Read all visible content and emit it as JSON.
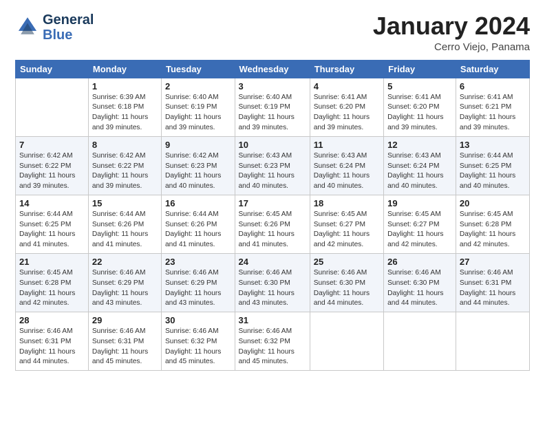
{
  "header": {
    "logo_line1": "General",
    "logo_line2": "Blue",
    "month_title": "January 2024",
    "subtitle": "Cerro Viejo, Panama"
  },
  "days_of_week": [
    "Sunday",
    "Monday",
    "Tuesday",
    "Wednesday",
    "Thursday",
    "Friday",
    "Saturday"
  ],
  "weeks": [
    [
      {
        "day": "",
        "info": ""
      },
      {
        "day": "1",
        "info": "Sunrise: 6:39 AM\nSunset: 6:18 PM\nDaylight: 11 hours\nand 39 minutes."
      },
      {
        "day": "2",
        "info": "Sunrise: 6:40 AM\nSunset: 6:19 PM\nDaylight: 11 hours\nand 39 minutes."
      },
      {
        "day": "3",
        "info": "Sunrise: 6:40 AM\nSunset: 6:19 PM\nDaylight: 11 hours\nand 39 minutes."
      },
      {
        "day": "4",
        "info": "Sunrise: 6:41 AM\nSunset: 6:20 PM\nDaylight: 11 hours\nand 39 minutes."
      },
      {
        "day": "5",
        "info": "Sunrise: 6:41 AM\nSunset: 6:20 PM\nDaylight: 11 hours\nand 39 minutes."
      },
      {
        "day": "6",
        "info": "Sunrise: 6:41 AM\nSunset: 6:21 PM\nDaylight: 11 hours\nand 39 minutes."
      }
    ],
    [
      {
        "day": "7",
        "info": "Sunrise: 6:42 AM\nSunset: 6:22 PM\nDaylight: 11 hours\nand 39 minutes."
      },
      {
        "day": "8",
        "info": "Sunrise: 6:42 AM\nSunset: 6:22 PM\nDaylight: 11 hours\nand 39 minutes."
      },
      {
        "day": "9",
        "info": "Sunrise: 6:42 AM\nSunset: 6:23 PM\nDaylight: 11 hours\nand 40 minutes."
      },
      {
        "day": "10",
        "info": "Sunrise: 6:43 AM\nSunset: 6:23 PM\nDaylight: 11 hours\nand 40 minutes."
      },
      {
        "day": "11",
        "info": "Sunrise: 6:43 AM\nSunset: 6:24 PM\nDaylight: 11 hours\nand 40 minutes."
      },
      {
        "day": "12",
        "info": "Sunrise: 6:43 AM\nSunset: 6:24 PM\nDaylight: 11 hours\nand 40 minutes."
      },
      {
        "day": "13",
        "info": "Sunrise: 6:44 AM\nSunset: 6:25 PM\nDaylight: 11 hours\nand 40 minutes."
      }
    ],
    [
      {
        "day": "14",
        "info": "Sunrise: 6:44 AM\nSunset: 6:25 PM\nDaylight: 11 hours\nand 41 minutes."
      },
      {
        "day": "15",
        "info": "Sunrise: 6:44 AM\nSunset: 6:26 PM\nDaylight: 11 hours\nand 41 minutes."
      },
      {
        "day": "16",
        "info": "Sunrise: 6:44 AM\nSunset: 6:26 PM\nDaylight: 11 hours\nand 41 minutes."
      },
      {
        "day": "17",
        "info": "Sunrise: 6:45 AM\nSunset: 6:26 PM\nDaylight: 11 hours\nand 41 minutes."
      },
      {
        "day": "18",
        "info": "Sunrise: 6:45 AM\nSunset: 6:27 PM\nDaylight: 11 hours\nand 42 minutes."
      },
      {
        "day": "19",
        "info": "Sunrise: 6:45 AM\nSunset: 6:27 PM\nDaylight: 11 hours\nand 42 minutes."
      },
      {
        "day": "20",
        "info": "Sunrise: 6:45 AM\nSunset: 6:28 PM\nDaylight: 11 hours\nand 42 minutes."
      }
    ],
    [
      {
        "day": "21",
        "info": "Sunrise: 6:45 AM\nSunset: 6:28 PM\nDaylight: 11 hours\nand 42 minutes."
      },
      {
        "day": "22",
        "info": "Sunrise: 6:46 AM\nSunset: 6:29 PM\nDaylight: 11 hours\nand 43 minutes."
      },
      {
        "day": "23",
        "info": "Sunrise: 6:46 AM\nSunset: 6:29 PM\nDaylight: 11 hours\nand 43 minutes."
      },
      {
        "day": "24",
        "info": "Sunrise: 6:46 AM\nSunset: 6:30 PM\nDaylight: 11 hours\nand 43 minutes."
      },
      {
        "day": "25",
        "info": "Sunrise: 6:46 AM\nSunset: 6:30 PM\nDaylight: 11 hours\nand 44 minutes."
      },
      {
        "day": "26",
        "info": "Sunrise: 6:46 AM\nSunset: 6:30 PM\nDaylight: 11 hours\nand 44 minutes."
      },
      {
        "day": "27",
        "info": "Sunrise: 6:46 AM\nSunset: 6:31 PM\nDaylight: 11 hours\nand 44 minutes."
      }
    ],
    [
      {
        "day": "28",
        "info": "Sunrise: 6:46 AM\nSunset: 6:31 PM\nDaylight: 11 hours\nand 44 minutes."
      },
      {
        "day": "29",
        "info": "Sunrise: 6:46 AM\nSunset: 6:31 PM\nDaylight: 11 hours\nand 45 minutes."
      },
      {
        "day": "30",
        "info": "Sunrise: 6:46 AM\nSunset: 6:32 PM\nDaylight: 11 hours\nand 45 minutes."
      },
      {
        "day": "31",
        "info": "Sunrise: 6:46 AM\nSunset: 6:32 PM\nDaylight: 11 hours\nand 45 minutes."
      },
      {
        "day": "",
        "info": ""
      },
      {
        "day": "",
        "info": ""
      },
      {
        "day": "",
        "info": ""
      }
    ]
  ]
}
